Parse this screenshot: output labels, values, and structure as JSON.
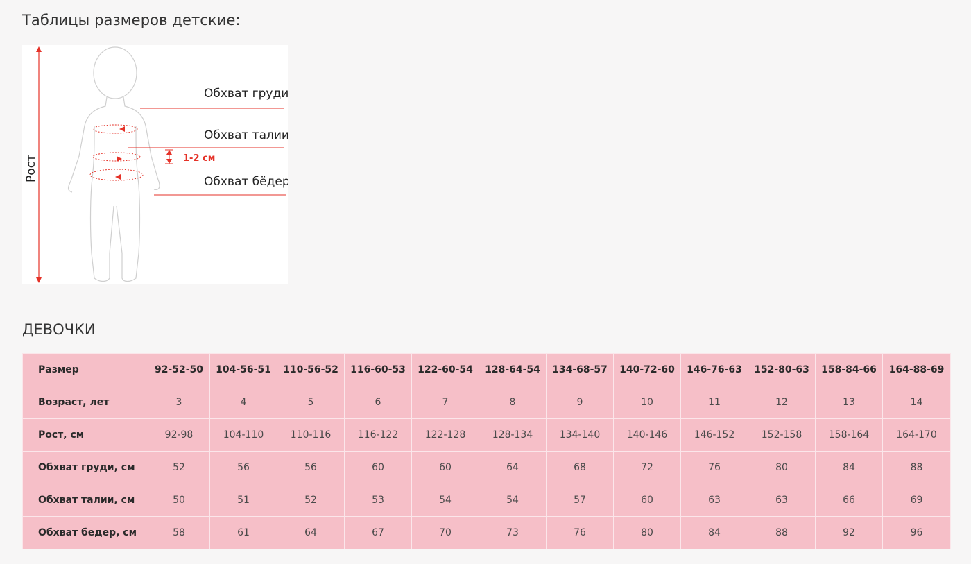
{
  "page_title": "Таблицы размеров детские:",
  "figure": {
    "labels": {
      "height": "Рост",
      "chest": "Обхват груди",
      "waist": "Обхват талии",
      "offset": "1-2 см",
      "hips": "Обхват бёдер"
    },
    "accent_color": "#e53228"
  },
  "section_title": "ДЕВОЧКИ",
  "table": {
    "header": {
      "label": "Размер",
      "cells": [
        "92-52-50",
        "104-56-51",
        "110-56-52",
        "116-60-53",
        "122-60-54",
        "128-64-54",
        "134-68-57",
        "140-72-60",
        "146-76-63",
        "152-80-63",
        "158-84-66",
        "164-88-69"
      ]
    },
    "rows": [
      {
        "label": "Возраст, лет",
        "cells": [
          "3",
          "4",
          "5",
          "6",
          "7",
          "8",
          "9",
          "10",
          "11",
          "12",
          "13",
          "14"
        ]
      },
      {
        "label": "Рост, см",
        "cells": [
          "92-98",
          "104-110",
          "110-116",
          "116-122",
          "122-128",
          "128-134",
          "134-140",
          "140-146",
          "146-152",
          "152-158",
          "158-164",
          "164-170"
        ]
      },
      {
        "label": "Обхват груди, см",
        "cells": [
          "52",
          "56",
          "56",
          "60",
          "60",
          "64",
          "68",
          "72",
          "76",
          "80",
          "84",
          "88"
        ]
      },
      {
        "label": "Обхват талии, см",
        "cells": [
          "50",
          "51",
          "52",
          "53",
          "54",
          "54",
          "57",
          "60",
          "63",
          "63",
          "66",
          "69"
        ]
      },
      {
        "label": "Обхват бедер, см",
        "cells": [
          "58",
          "61",
          "64",
          "67",
          "70",
          "73",
          "76",
          "80",
          "84",
          "88",
          "92",
          "96"
        ]
      }
    ],
    "cell_color": "#f6bfc8"
  }
}
